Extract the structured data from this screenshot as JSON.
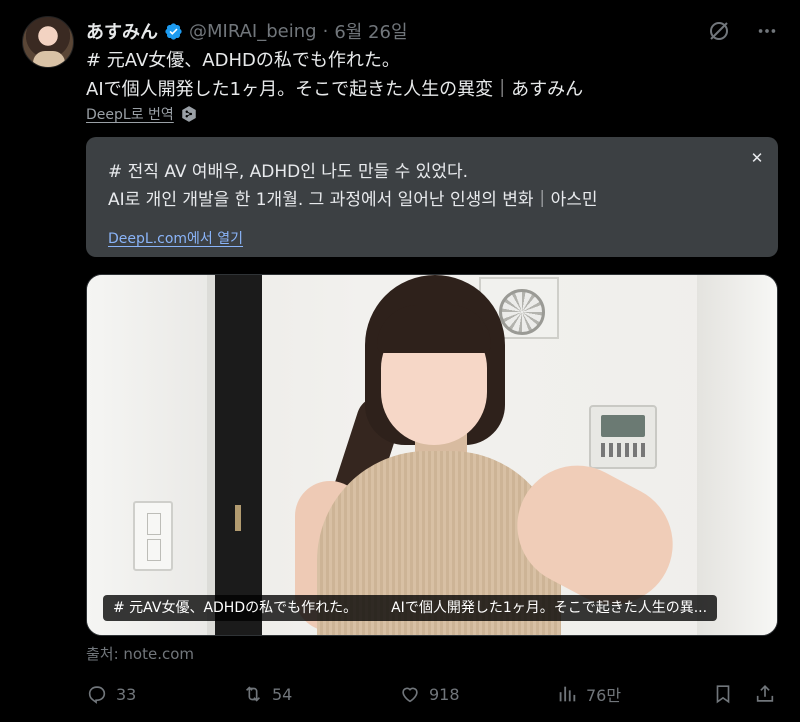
{
  "author": {
    "display_name": "あすみん",
    "handle": "@MIRAI_being",
    "separator": "·",
    "date": "6월 26일"
  },
  "tweet": {
    "lines": [
      "# 元AV女優、ADHDの私でも作れた。",
      "AIで個人開発した1ヶ月。そこで起きた人生の異変｜あすみん"
    ]
  },
  "translate": {
    "link_label": "DeepL로 번역"
  },
  "translation_card": {
    "lines": [
      "# 전직 AV 여배우, ADHD인 나도 만들 수 있었다.",
      " AI로 개인 개발을 한 1개월. 그 과정에서 일어난 인생의 변화｜아스민"
    ],
    "open_link": "DeepL.com에서 열기",
    "close_glyph": "✕"
  },
  "media": {
    "caption_left": "# 元AV女優、ADHDの私でも作れた。",
    "caption_right": "AIで個人開発した1ヶ月。そこで起きた人生の異..."
  },
  "source": "출처: note.com",
  "actions": {
    "replies": "33",
    "reposts": "54",
    "likes": "918",
    "views": "76만"
  },
  "colors": {
    "background": "#000000",
    "muted": "#71767b",
    "verified": "#1d9bf0",
    "card": "#3c4043",
    "link": "#8ab4f8"
  }
}
